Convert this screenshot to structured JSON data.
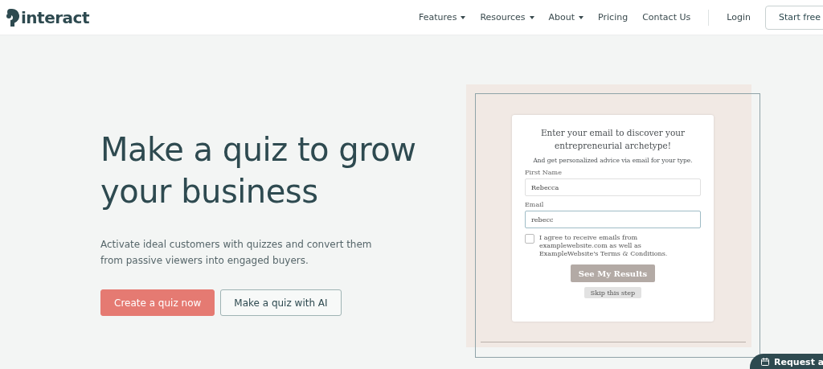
{
  "header": {
    "logo": "interact",
    "nav": [
      {
        "label": "Features",
        "dropdown": true
      },
      {
        "label": "Resources",
        "dropdown": true
      },
      {
        "label": "About",
        "dropdown": true
      },
      {
        "label": "Pricing",
        "dropdown": false
      },
      {
        "label": "Contact Us",
        "dropdown": false
      }
    ],
    "login": "Login",
    "cta": "Start free"
  },
  "hero": {
    "title": "Make a quiz to grow your business",
    "subtitle": "Activate ideal customers with quizzes and convert them from passive viewers into engaged buyers.",
    "buttons": [
      {
        "label": "Create a quiz now",
        "kind": "primary"
      },
      {
        "label": "Make a quiz with AI",
        "kind": "secondary"
      }
    ]
  },
  "quiz": {
    "heading": "Enter your email to discover your entrepreneurial archetype!",
    "subheading": "And get personalized advice via email for your type.",
    "fields": [
      {
        "label": "First Name",
        "value": "Rebecca",
        "focused": false
      },
      {
        "label": "Email",
        "value": "rebecc",
        "focused": true
      }
    ],
    "consent": {
      "text": "I agree to receive emails from examplewebsite.com as well as ExampleWebsite's Terms & Conditions.",
      "checked": false
    },
    "submit": {
      "label": "See My Results",
      "disabled": true
    },
    "skip": "Skip this step"
  },
  "request_button": {
    "label": "Request a"
  }
}
